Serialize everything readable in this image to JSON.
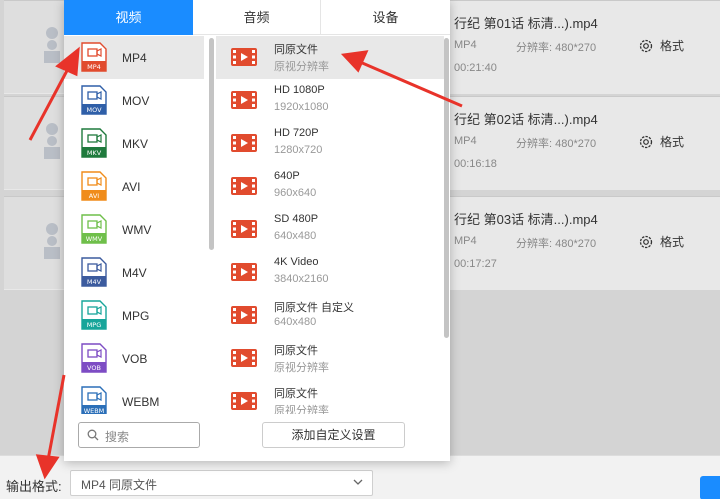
{
  "tabs": [
    {
      "label": "视频",
      "active": true
    },
    {
      "label": "音频",
      "active": false
    },
    {
      "label": "设备",
      "active": false
    }
  ],
  "formats": [
    {
      "name": "MP4",
      "badge": "MP4",
      "color": "#e14b2e",
      "selected": true
    },
    {
      "name": "MOV",
      "badge": "MOV",
      "color": "#2f5fa8",
      "selected": false
    },
    {
      "name": "MKV",
      "badge": "MKV",
      "color": "#1f7a3d",
      "selected": false
    },
    {
      "name": "AVI",
      "badge": "AVI",
      "color": "#f08c1a",
      "selected": false
    },
    {
      "name": "WMV",
      "badge": "WMV",
      "color": "#6fbf4a",
      "selected": false
    },
    {
      "name": "M4V",
      "badge": "M4V",
      "color": "#3c5b9e",
      "selected": false
    },
    {
      "name": "MPG",
      "badge": "MPG",
      "color": "#17a59a",
      "selected": false
    },
    {
      "name": "VOB",
      "badge": "VOB",
      "color": "#7d4cc4",
      "selected": false
    },
    {
      "name": "WEBM",
      "badge": "WEBM",
      "color": "#2b6fb8",
      "selected": false
    }
  ],
  "qualities": [
    {
      "name": "同原文件",
      "sub": "原视分辨率",
      "selected": true
    },
    {
      "name": "HD 1080P",
      "sub": "1920x1080",
      "selected": false
    },
    {
      "name": "HD 720P",
      "sub": "1280x720",
      "selected": false
    },
    {
      "name": "640P",
      "sub": "960x640",
      "selected": false
    },
    {
      "name": "SD 480P",
      "sub": "640x480",
      "selected": false
    },
    {
      "name": "4K Video",
      "sub": "3840x2160",
      "selected": false
    },
    {
      "name": "同原文件 自定义",
      "sub": "640x480",
      "selected": false
    },
    {
      "name": "同原文件",
      "sub": "原视分辨率",
      "selected": false
    },
    {
      "name": "同原文件",
      "sub": "原视分辨率",
      "selected": false
    }
  ],
  "search": {
    "placeholder": "搜索"
  },
  "add_custom": "添加自定义设置",
  "output": {
    "label": "输出格式:",
    "value": "MP4  同原文件"
  },
  "files": [
    {
      "title": "行纪 第01话 标清...).mp4",
      "format": "MP4",
      "resolution": "分辨率: 480*270",
      "duration": "00:21:40",
      "settings": "格式"
    },
    {
      "title": "行纪 第02话 标清...).mp4",
      "format": "MP4",
      "resolution": "分辨率: 480*270",
      "duration": "00:16:18",
      "settings": "格式"
    },
    {
      "title": "行纪 第03话 标清...).mp4",
      "format": "MP4",
      "resolution": "分辨率: 480*270",
      "duration": "00:17:27",
      "settings": "格式"
    }
  ],
  "colors": {
    "accent": "#1a8cff",
    "arrow": "#e8332a",
    "film_icon": "#e14b2e"
  }
}
